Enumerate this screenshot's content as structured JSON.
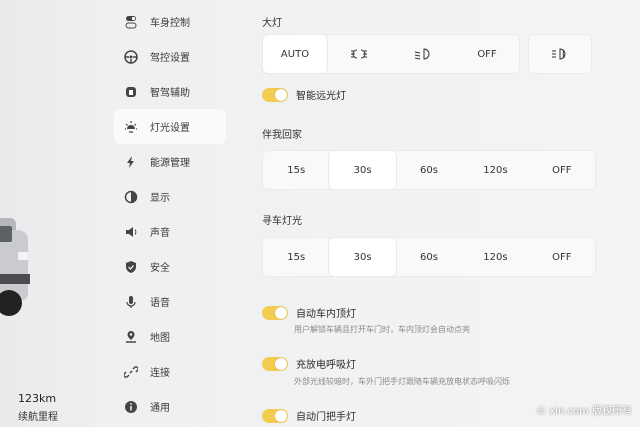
{
  "sidebar": {
    "items": [
      {
        "label": "车身控制",
        "icon": "vehicle-toggle-icon"
      },
      {
        "label": "驾控设置",
        "icon": "steering-wheel-icon"
      },
      {
        "label": "智驾辅助",
        "icon": "assist-driving-icon"
      },
      {
        "label": "灯光设置",
        "icon": "light-icon",
        "active": true
      },
      {
        "label": "能源管理",
        "icon": "lightning-icon"
      },
      {
        "label": "显示",
        "icon": "display-icon"
      },
      {
        "label": "声音",
        "icon": "speaker-icon"
      },
      {
        "label": "安全",
        "icon": "shield-icon"
      },
      {
        "label": "语音",
        "icon": "microphone-icon"
      },
      {
        "label": "地图",
        "icon": "map-pin-icon"
      },
      {
        "label": "连接",
        "icon": "link-icon"
      },
      {
        "label": "通用",
        "icon": "info-icon"
      }
    ]
  },
  "vehicle": {
    "range_value": "123km",
    "range_label": "续航里程"
  },
  "lights": {
    "headlight_title": "大灯",
    "headlight_options": [
      "AUTO",
      "position-light-icon",
      "low-beam-icon",
      "OFF"
    ],
    "headlight_selected": "AUTO",
    "fog_light_icon": "fog-light-icon",
    "smart_high_beam_label": "智能远光灯",
    "smart_high_beam_on": true,
    "follow_me_home_title": "伴我回家",
    "follow_me_home_options": [
      "15s",
      "30s",
      "60s",
      "120s",
      "OFF"
    ],
    "follow_me_home_selected": "30s",
    "find_car_title": "寻车灯光",
    "find_car_options": [
      "15s",
      "30s",
      "60s",
      "120s",
      "OFF"
    ],
    "find_car_selected": "30s",
    "auto_dome_label": "自动车内顶灯",
    "auto_dome_desc": "用户解锁车辆且打开车门时，车内顶灯会自动点亮",
    "auto_dome_on": true,
    "charge_breath_label": "充放电呼吸灯",
    "charge_breath_desc": "外部光线较暗时，车外门把手灯跟随车辆充放电状态呼吸闪烁",
    "charge_breath_on": true,
    "auto_handle_label": "自动门把手灯",
    "auto_handle_on": true
  },
  "watermark": "© xin.com 版权所有",
  "colors": {
    "toggle_on": "#f3cc4f",
    "active_item_bg": "#fafafa"
  }
}
